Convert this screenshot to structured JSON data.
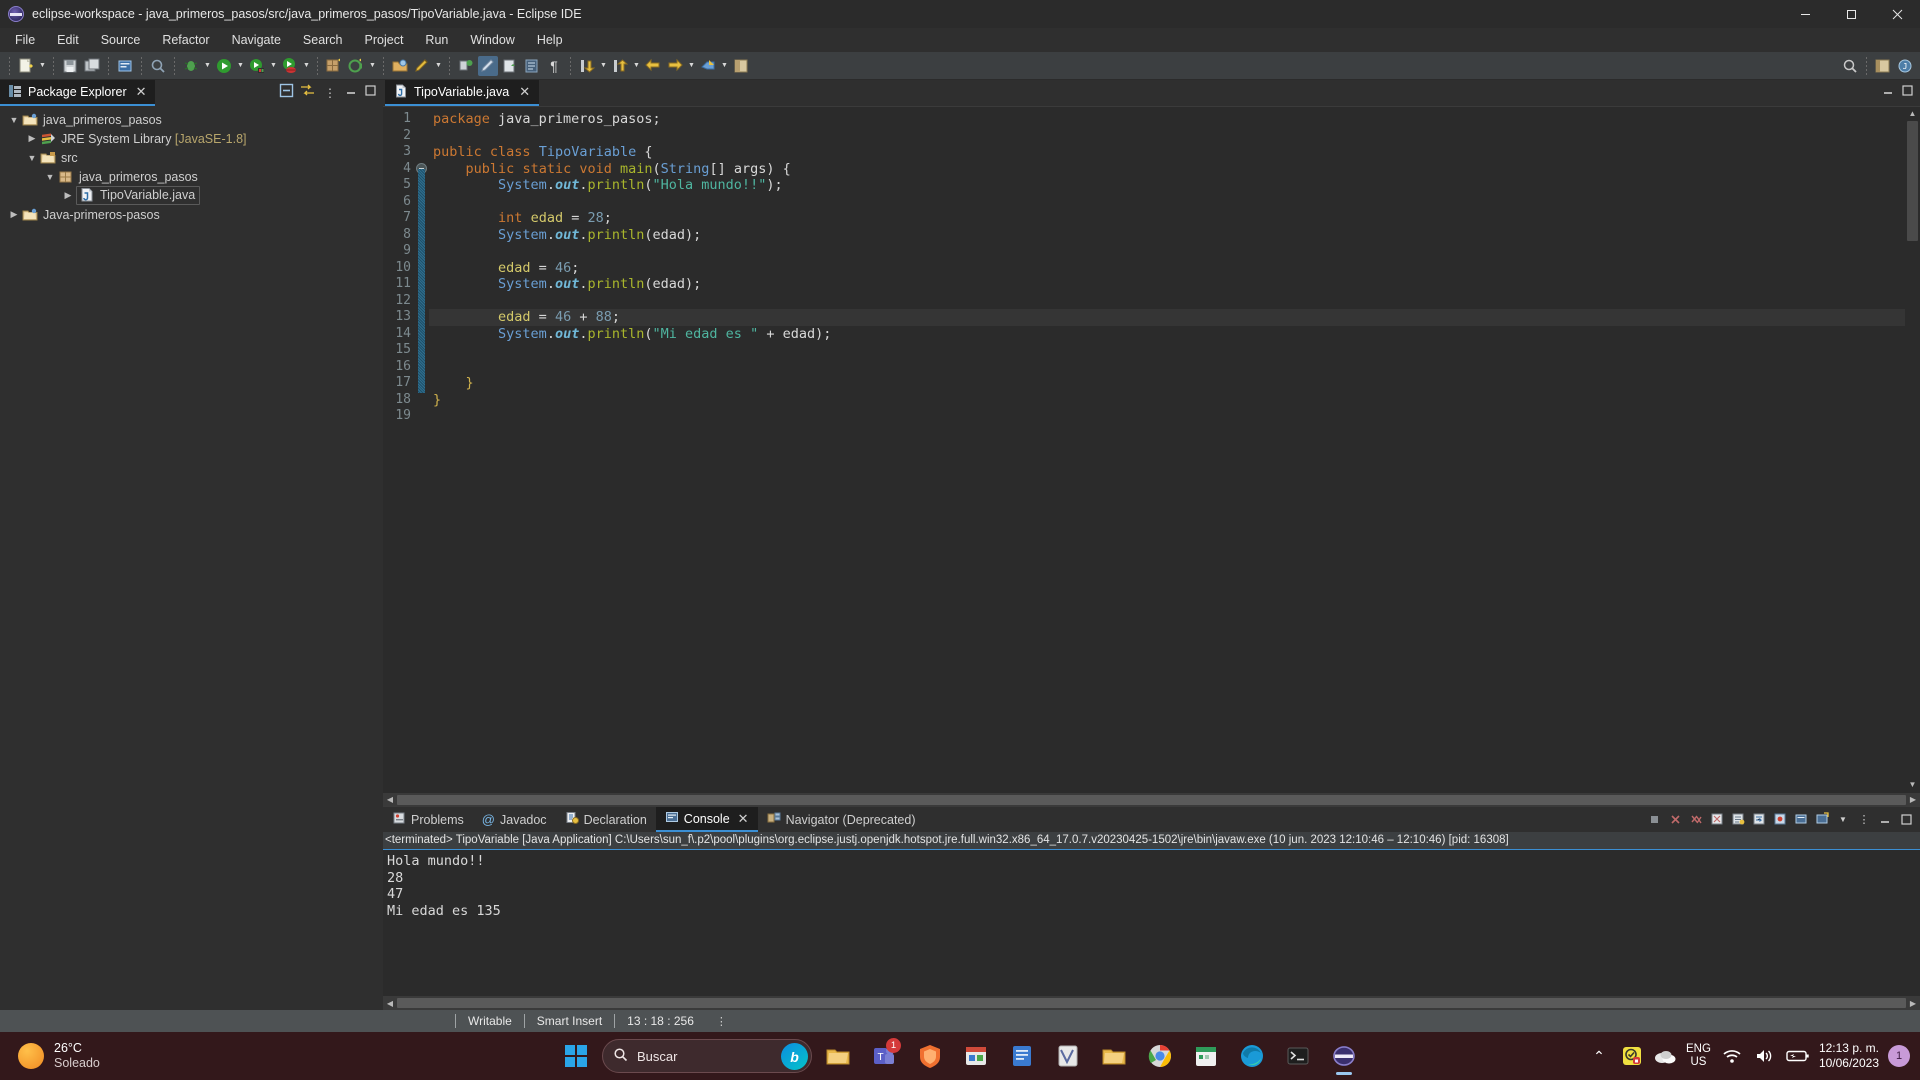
{
  "window": {
    "title": "eclipse-workspace - java_primeros_pasos/src/java_primeros_pasos/TipoVariable.java - Eclipse IDE",
    "logo_icon": "eclipse-logo-icon",
    "minimize_label": "–",
    "maximize_label": "❐",
    "close_label": "✕"
  },
  "menubar": {
    "items": [
      {
        "label": "File"
      },
      {
        "label": "Edit"
      },
      {
        "label": "Source"
      },
      {
        "label": "Refactor"
      },
      {
        "label": "Navigate"
      },
      {
        "label": "Search"
      },
      {
        "label": "Project"
      },
      {
        "label": "Run"
      },
      {
        "label": "Window"
      },
      {
        "label": "Help"
      }
    ]
  },
  "toolbar": {
    "search_icon": "search-icon",
    "perspective_java_icon": "java-perspective-icon",
    "perspective_open_icon": "open-perspective-icon"
  },
  "explorer": {
    "tab_label": "Package Explorer",
    "tab_icon": "package-explorer-icon",
    "close_icon": "close-icon",
    "collapse_all_icon": "collapse-all-icon",
    "link_editor_icon": "link-with-editor-icon",
    "minimize_icon": "minimize-icon",
    "maximize_icon": "maximize-icon",
    "view_menu_icon": "view-menu-icon",
    "tree": [
      {
        "label": "java_primeros_pasos",
        "suffix": "",
        "depth": 0,
        "twisty": "down",
        "icon": "java-project-icon",
        "selected": false
      },
      {
        "label": "JRE System Library",
        "suffix": " [JavaSE-1.8]",
        "depth": 1,
        "twisty": "right",
        "icon": "library-icon",
        "selected": false
      },
      {
        "label": "src",
        "suffix": "",
        "depth": 1,
        "twisty": "down",
        "icon": "source-folder-icon",
        "selected": false
      },
      {
        "label": "java_primeros_pasos",
        "suffix": "",
        "depth": 2,
        "twisty": "down",
        "icon": "package-icon",
        "selected": false
      },
      {
        "label": "TipoVariable.java",
        "suffix": "",
        "depth": 3,
        "twisty": "right",
        "icon": "java-file-icon",
        "selected": true
      },
      {
        "label": "Java-primeros-pasos",
        "suffix": "",
        "depth": 0,
        "twisty": "right",
        "icon": "java-project-icon",
        "selected": false
      }
    ]
  },
  "editor": {
    "tab_label": "TipoVariable.java",
    "tab_icon": "java-file-icon",
    "close_icon": "close-icon",
    "minimize_icon": "minimize-icon",
    "maximize_icon": "maximize-icon",
    "current_line": 13,
    "lines": [
      {
        "n": 1,
        "tokens": [
          {
            "t": "package",
            "c": "k"
          },
          {
            "t": " java_primeros_pasos;",
            "c": "pl"
          }
        ]
      },
      {
        "n": 2,
        "tokens": []
      },
      {
        "n": 3,
        "tokens": [
          {
            "t": "public",
            "c": "k"
          },
          {
            "t": " ",
            "c": "pl"
          },
          {
            "t": "class",
            "c": "k"
          },
          {
            "t": " ",
            "c": "pl"
          },
          {
            "t": "TipoVariable",
            "c": "cls"
          },
          {
            "t": " {",
            "c": "pl"
          }
        ]
      },
      {
        "n": 4,
        "tokens": [
          {
            "t": "    ",
            "c": "pl"
          },
          {
            "t": "public",
            "c": "k"
          },
          {
            "t": " ",
            "c": "pl"
          },
          {
            "t": "static",
            "c": "k"
          },
          {
            "t": " ",
            "c": "pl"
          },
          {
            "t": "void",
            "c": "k"
          },
          {
            "t": " ",
            "c": "pl"
          },
          {
            "t": "main",
            "c": "mth"
          },
          {
            "t": "(",
            "c": "pl"
          },
          {
            "t": "String",
            "c": "cls"
          },
          {
            "t": "[] args) {",
            "c": "pl"
          }
        ],
        "fold": true
      },
      {
        "n": 5,
        "tokens": [
          {
            "t": "        ",
            "c": "pl"
          },
          {
            "t": "System",
            "c": "cls"
          },
          {
            "t": ".",
            "c": "pl"
          },
          {
            "t": "out",
            "c": "fld"
          },
          {
            "t": ".",
            "c": "pl"
          },
          {
            "t": "println",
            "c": "mth"
          },
          {
            "t": "(",
            "c": "pl"
          },
          {
            "t": "\"Hola mundo!!\"",
            "c": "str"
          },
          {
            "t": ");",
            "c": "pl"
          }
        ]
      },
      {
        "n": 6,
        "tokens": []
      },
      {
        "n": 7,
        "tokens": [
          {
            "t": "        ",
            "c": "pl"
          },
          {
            "t": "int",
            "c": "k"
          },
          {
            "t": " ",
            "c": "pl"
          },
          {
            "t": "edad",
            "c": "var"
          },
          {
            "t": " = ",
            "c": "pl"
          },
          {
            "t": "28",
            "c": "num"
          },
          {
            "t": ";",
            "c": "pl"
          }
        ]
      },
      {
        "n": 8,
        "tokens": [
          {
            "t": "        ",
            "c": "pl"
          },
          {
            "t": "System",
            "c": "cls"
          },
          {
            "t": ".",
            "c": "pl"
          },
          {
            "t": "out",
            "c": "fld"
          },
          {
            "t": ".",
            "c": "pl"
          },
          {
            "t": "println",
            "c": "mth"
          },
          {
            "t": "(edad);",
            "c": "pl"
          }
        ]
      },
      {
        "n": 9,
        "tokens": []
      },
      {
        "n": 10,
        "tokens": [
          {
            "t": "        ",
            "c": "pl"
          },
          {
            "t": "edad",
            "c": "var"
          },
          {
            "t": " = ",
            "c": "pl"
          },
          {
            "t": "46",
            "c": "num"
          },
          {
            "t": ";",
            "c": "pl"
          }
        ]
      },
      {
        "n": 11,
        "tokens": [
          {
            "t": "        ",
            "c": "pl"
          },
          {
            "t": "System",
            "c": "cls"
          },
          {
            "t": ".",
            "c": "pl"
          },
          {
            "t": "out",
            "c": "fld"
          },
          {
            "t": ".",
            "c": "pl"
          },
          {
            "t": "println",
            "c": "mth"
          },
          {
            "t": "(edad);",
            "c": "pl"
          }
        ]
      },
      {
        "n": 12,
        "tokens": []
      },
      {
        "n": 13,
        "tokens": [
          {
            "t": "        ",
            "c": "pl"
          },
          {
            "t": "edad",
            "c": "var"
          },
          {
            "t": " = ",
            "c": "pl"
          },
          {
            "t": "46",
            "c": "num"
          },
          {
            "t": " + ",
            "c": "pl"
          },
          {
            "t": "88",
            "c": "num"
          },
          {
            "t": ";",
            "c": "pl"
          }
        ]
      },
      {
        "n": 14,
        "tokens": [
          {
            "t": "        ",
            "c": "pl"
          },
          {
            "t": "System",
            "c": "cls"
          },
          {
            "t": ".",
            "c": "pl"
          },
          {
            "t": "out",
            "c": "fld"
          },
          {
            "t": ".",
            "c": "pl"
          },
          {
            "t": "println",
            "c": "mth"
          },
          {
            "t": "(",
            "c": "pl"
          },
          {
            "t": "\"Mi edad es \"",
            "c": "str"
          },
          {
            "t": " + edad);",
            "c": "pl"
          }
        ]
      },
      {
        "n": 15,
        "tokens": []
      },
      {
        "n": 16,
        "tokens": []
      },
      {
        "n": 17,
        "tokens": [
          {
            "t": "    ",
            "c": "pl"
          },
          {
            "t": "}",
            "c": "br"
          }
        ]
      },
      {
        "n": 18,
        "tokens": [
          {
            "t": "}",
            "c": "br"
          }
        ]
      },
      {
        "n": 19,
        "tokens": []
      }
    ]
  },
  "console": {
    "tabs": [
      {
        "label": "Problems",
        "icon": "problems-icon",
        "active": false,
        "closable": false
      },
      {
        "label": "Javadoc",
        "icon": "javadoc-icon",
        "active": false,
        "closable": false
      },
      {
        "label": "Declaration",
        "icon": "declaration-icon",
        "active": false,
        "closable": false
      },
      {
        "label": "Console",
        "icon": "console-icon",
        "active": true,
        "closable": true
      },
      {
        "label": "Navigator (Deprecated)",
        "icon": "navigator-icon",
        "active": false,
        "closable": false
      }
    ],
    "header": "<terminated> TipoVariable [Java Application] C:\\Users\\sun_f\\.p2\\pool\\plugins\\org.eclipse.justj.openjdk.hotspot.jre.full.win32.x86_64_17.0.7.v20230425-1502\\jre\\bin\\javaw.exe  (10 jun. 2023 12:10:46 – 12:10:46) [pid: 16308]",
    "output": [
      "Hola mundo!!",
      "28",
      "47",
      "Mi edad es 135"
    ],
    "toolbar_icons": [
      "terminate-icon",
      "remove-launch-icon",
      "remove-all-launches-icon",
      "clear-console-icon",
      "scroll-lock-icon",
      "word-wrap-icon",
      "pin-console-icon",
      "display-selected-console-icon",
      "open-console-icon",
      "view-menu-icon",
      "minimize-icon",
      "maximize-icon"
    ]
  },
  "statusbar": {
    "writable": "Writable",
    "insert_mode": "Smart Insert",
    "position": "13 : 18 : 256"
  },
  "taskbar": {
    "weather_temp": "26°C",
    "weather_desc": "Soleado",
    "weather_icon": "sun-icon",
    "start_icon": "windows-start-icon",
    "search_placeholder": "Buscar",
    "search_icon": "search-icon",
    "bing_icon": "bing-icon",
    "apps": [
      {
        "name": "file-explorer-icon",
        "glyph": "▬",
        "badge": ""
      },
      {
        "name": "microsoft-teams-icon",
        "glyph": "▣",
        "badge": "1"
      },
      {
        "name": "antivirus-shield-icon",
        "glyph": "●",
        "badge": ""
      },
      {
        "name": "microsoft-store-icon",
        "glyph": "⊞",
        "badge": ""
      },
      {
        "name": "notes-app-icon",
        "glyph": "▤",
        "badge": ""
      },
      {
        "name": "onenote-icon",
        "glyph": "◧",
        "badge": ""
      },
      {
        "name": "file-manager-icon",
        "glyph": "▰",
        "badge": ""
      },
      {
        "name": "google-chrome-icon",
        "glyph": "◉",
        "badge": ""
      },
      {
        "name": "calendar-app-icon",
        "glyph": "▦",
        "badge": ""
      },
      {
        "name": "microsoft-edge-icon",
        "glyph": "◔",
        "badge": ""
      },
      {
        "name": "terminal-icon",
        "glyph": "▧",
        "badge": ""
      },
      {
        "name": "eclipse-ide-icon",
        "glyph": "⬭",
        "badge": ""
      }
    ],
    "chevron_up_icon": "show-hidden-icons-icon",
    "security_icon": "security-shield-icon",
    "onedrive_icon": "onedrive-icon",
    "language": "ENG",
    "language_region": "US",
    "wifi_icon": "wifi-icon",
    "volume_icon": "volume-icon",
    "battery_icon": "battery-icon",
    "time": "12:13 p. m.",
    "date": "10/06/2023",
    "notification_count": "1"
  }
}
